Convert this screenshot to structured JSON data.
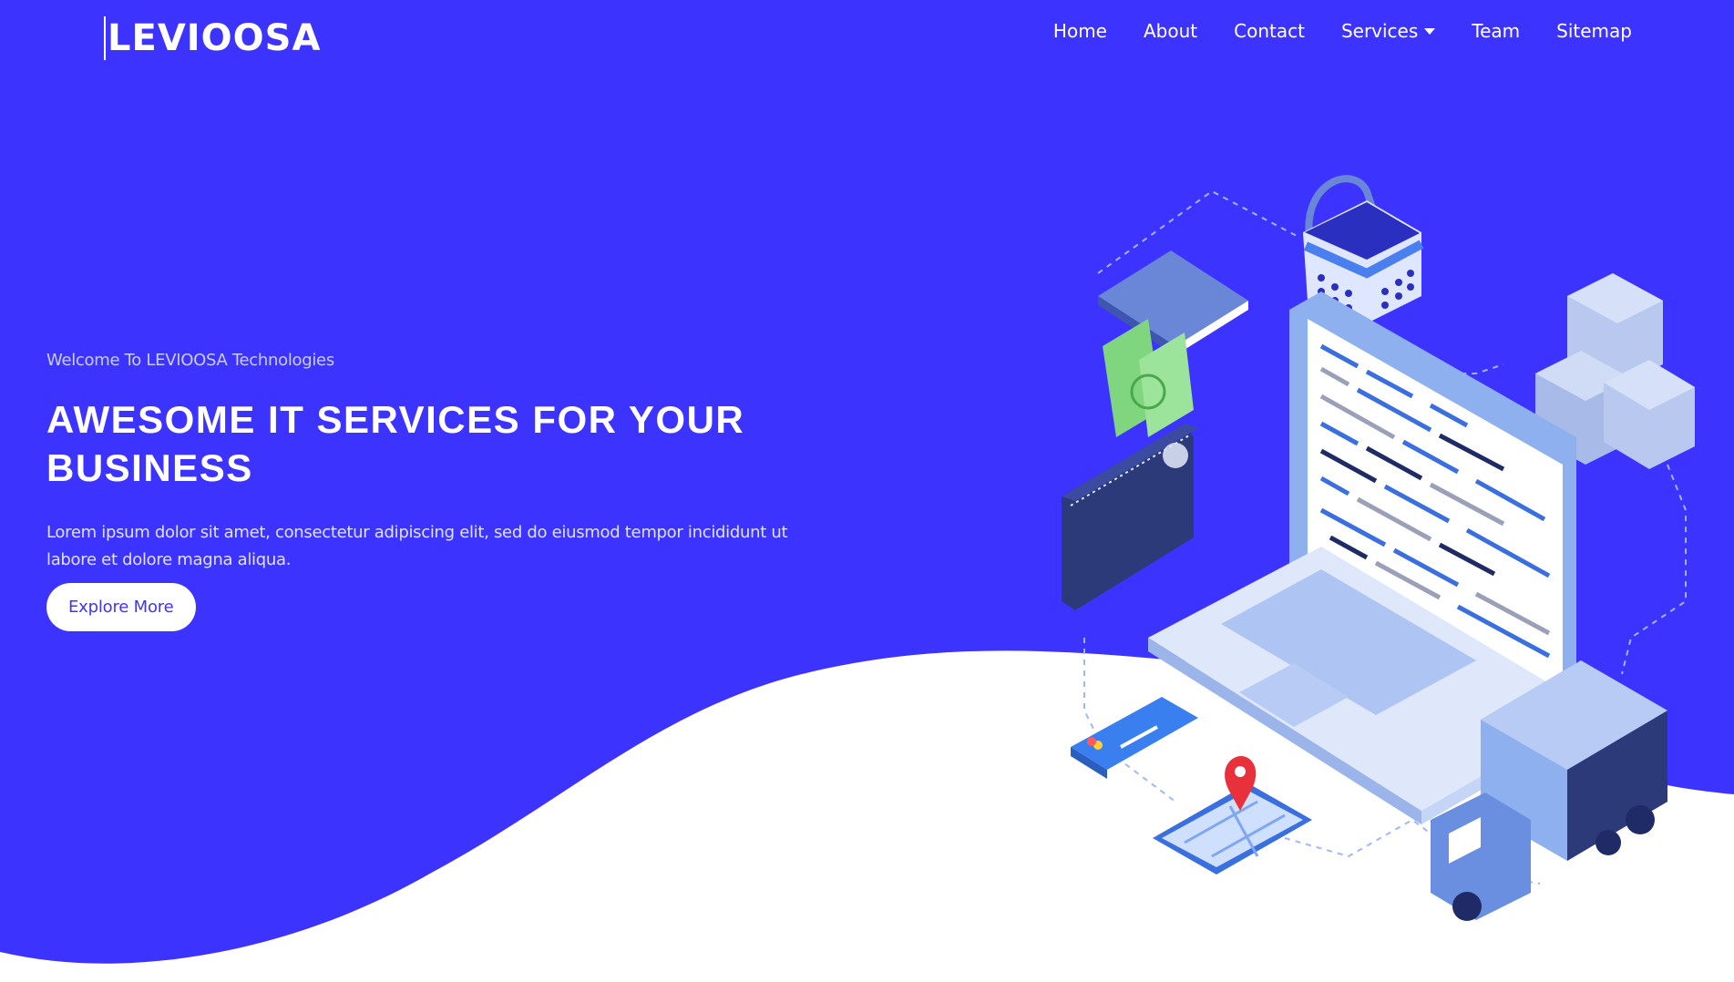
{
  "brand": {
    "logo_text": "LEVIOOSA"
  },
  "nav": {
    "items": [
      {
        "label": "Home"
      },
      {
        "label": "About"
      },
      {
        "label": "Contact"
      },
      {
        "label": "Services"
      },
      {
        "label": "Team"
      },
      {
        "label": "Sitemap"
      }
    ]
  },
  "hero": {
    "welcome": "Welcome To LEVIOOSA Technologies",
    "headline": "AWESOME IT SERVICES FOR YOUR BUSINESS",
    "description": "Lorem ipsum dolor sit amet, consectetur adipiscing elit, sed do eiusmod tempor incididunt ut labore et dolore magna aliqua.",
    "cta_label": "Explore More"
  },
  "colors": {
    "primary": "#3d33ff",
    "background_lower": "#ffffff"
  },
  "icons": [
    "caret-down-icon",
    "laptop-icon",
    "notebook-icon",
    "basket-icon",
    "boxes-icon",
    "wallet-icon",
    "credit-card-icon",
    "map-phone-icon",
    "truck-icon",
    "location-pin-icon"
  ]
}
